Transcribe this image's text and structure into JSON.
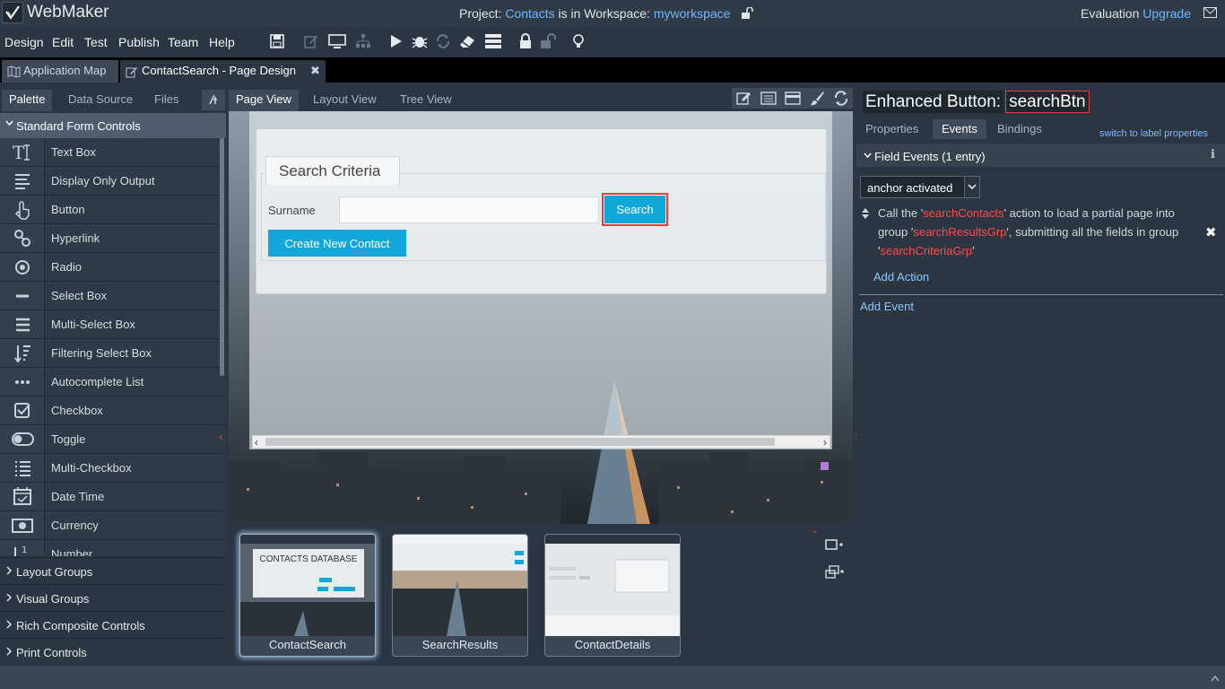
{
  "app": {
    "name": "WebMaker"
  },
  "header": {
    "project_prefix": "Project:",
    "project_name": "Contacts",
    "project_mid": "is in Workspace:",
    "workspace": "myworkspace",
    "evaluation": "Evaluation",
    "upgrade": "Upgrade"
  },
  "menu": [
    "Design",
    "Edit",
    "Test",
    "Publish",
    "Team",
    "Help"
  ],
  "toolbar_icons": [
    "save-icon",
    "edit-icon",
    "monitor-icon",
    "hierarchy-icon",
    "play-icon",
    "bug-icon",
    "refresh-icon",
    "eraser-icon",
    "server-icon",
    "lock-icon",
    "unlock-icon",
    "lightbulb-icon"
  ],
  "tabs": [
    {
      "label": "Application Map"
    },
    {
      "label": "ContactSearch - Page Design"
    }
  ],
  "left_panel": {
    "tabs": [
      "Palette",
      "Data Source",
      "Files"
    ],
    "section": "Standard Form Controls",
    "items": [
      {
        "label": "Text Box",
        "icon": "textbox-icon"
      },
      {
        "label": "Display Only Output",
        "icon": "display-output-icon"
      },
      {
        "label": "Button",
        "icon": "button-hand-icon"
      },
      {
        "label": "Hyperlink",
        "icon": "hyperlink-icon"
      },
      {
        "label": "Radio",
        "icon": "radio-icon"
      },
      {
        "label": "Select Box",
        "icon": "select-icon"
      },
      {
        "label": "Multi-Select Box",
        "icon": "multiselect-icon"
      },
      {
        "label": "Filtering Select Box",
        "icon": "filter-select-icon"
      },
      {
        "label": "Autocomplete List",
        "icon": "autocomplete-icon"
      },
      {
        "label": "Checkbox",
        "icon": "checkbox-icon"
      },
      {
        "label": "Toggle",
        "icon": "toggle-icon"
      },
      {
        "label": "Multi-Checkbox",
        "icon": "multicheckbox-icon"
      },
      {
        "label": "Date Time",
        "icon": "calendar-icon"
      },
      {
        "label": "Currency",
        "icon": "currency-icon"
      },
      {
        "label": "Number",
        "icon": "number-icon"
      }
    ],
    "groups": [
      "Layout Groups",
      "Visual Groups",
      "Rich Composite Controls",
      "Print Controls"
    ]
  },
  "center": {
    "view_tabs": [
      "Page View",
      "Layout View",
      "Tree View"
    ],
    "form": {
      "legend": "Search Criteria",
      "surname_label": "Surname",
      "surname_value": "",
      "search_button": "Search",
      "create_button": "Create New Contact"
    },
    "thumbnails": [
      {
        "label": "ContactSearch",
        "heading": "CONTACTS DATABASE"
      },
      {
        "label": "SearchResults"
      },
      {
        "label": "ContactDetails"
      }
    ]
  },
  "right_panel": {
    "title_prefix": "Enhanced Button:",
    "title_name": "searchBtn",
    "tabs": [
      "Properties",
      "Events",
      "Bindings"
    ],
    "switch_link": "switch to label properties",
    "field_events_header": "Field Events (1 entry)",
    "event_select": "anchor activated",
    "action": {
      "p1": "Call the '",
      "action_name": "searchContacts",
      "p2": "' action to load a partial page into group '",
      "group1": "searchResultsGrp",
      "p3": "', submitting all the fields in group '",
      "group2": "searchCriteriaGrp",
      "p4": "'"
    },
    "add_action": "Add Action",
    "add_event": "Add Event"
  }
}
